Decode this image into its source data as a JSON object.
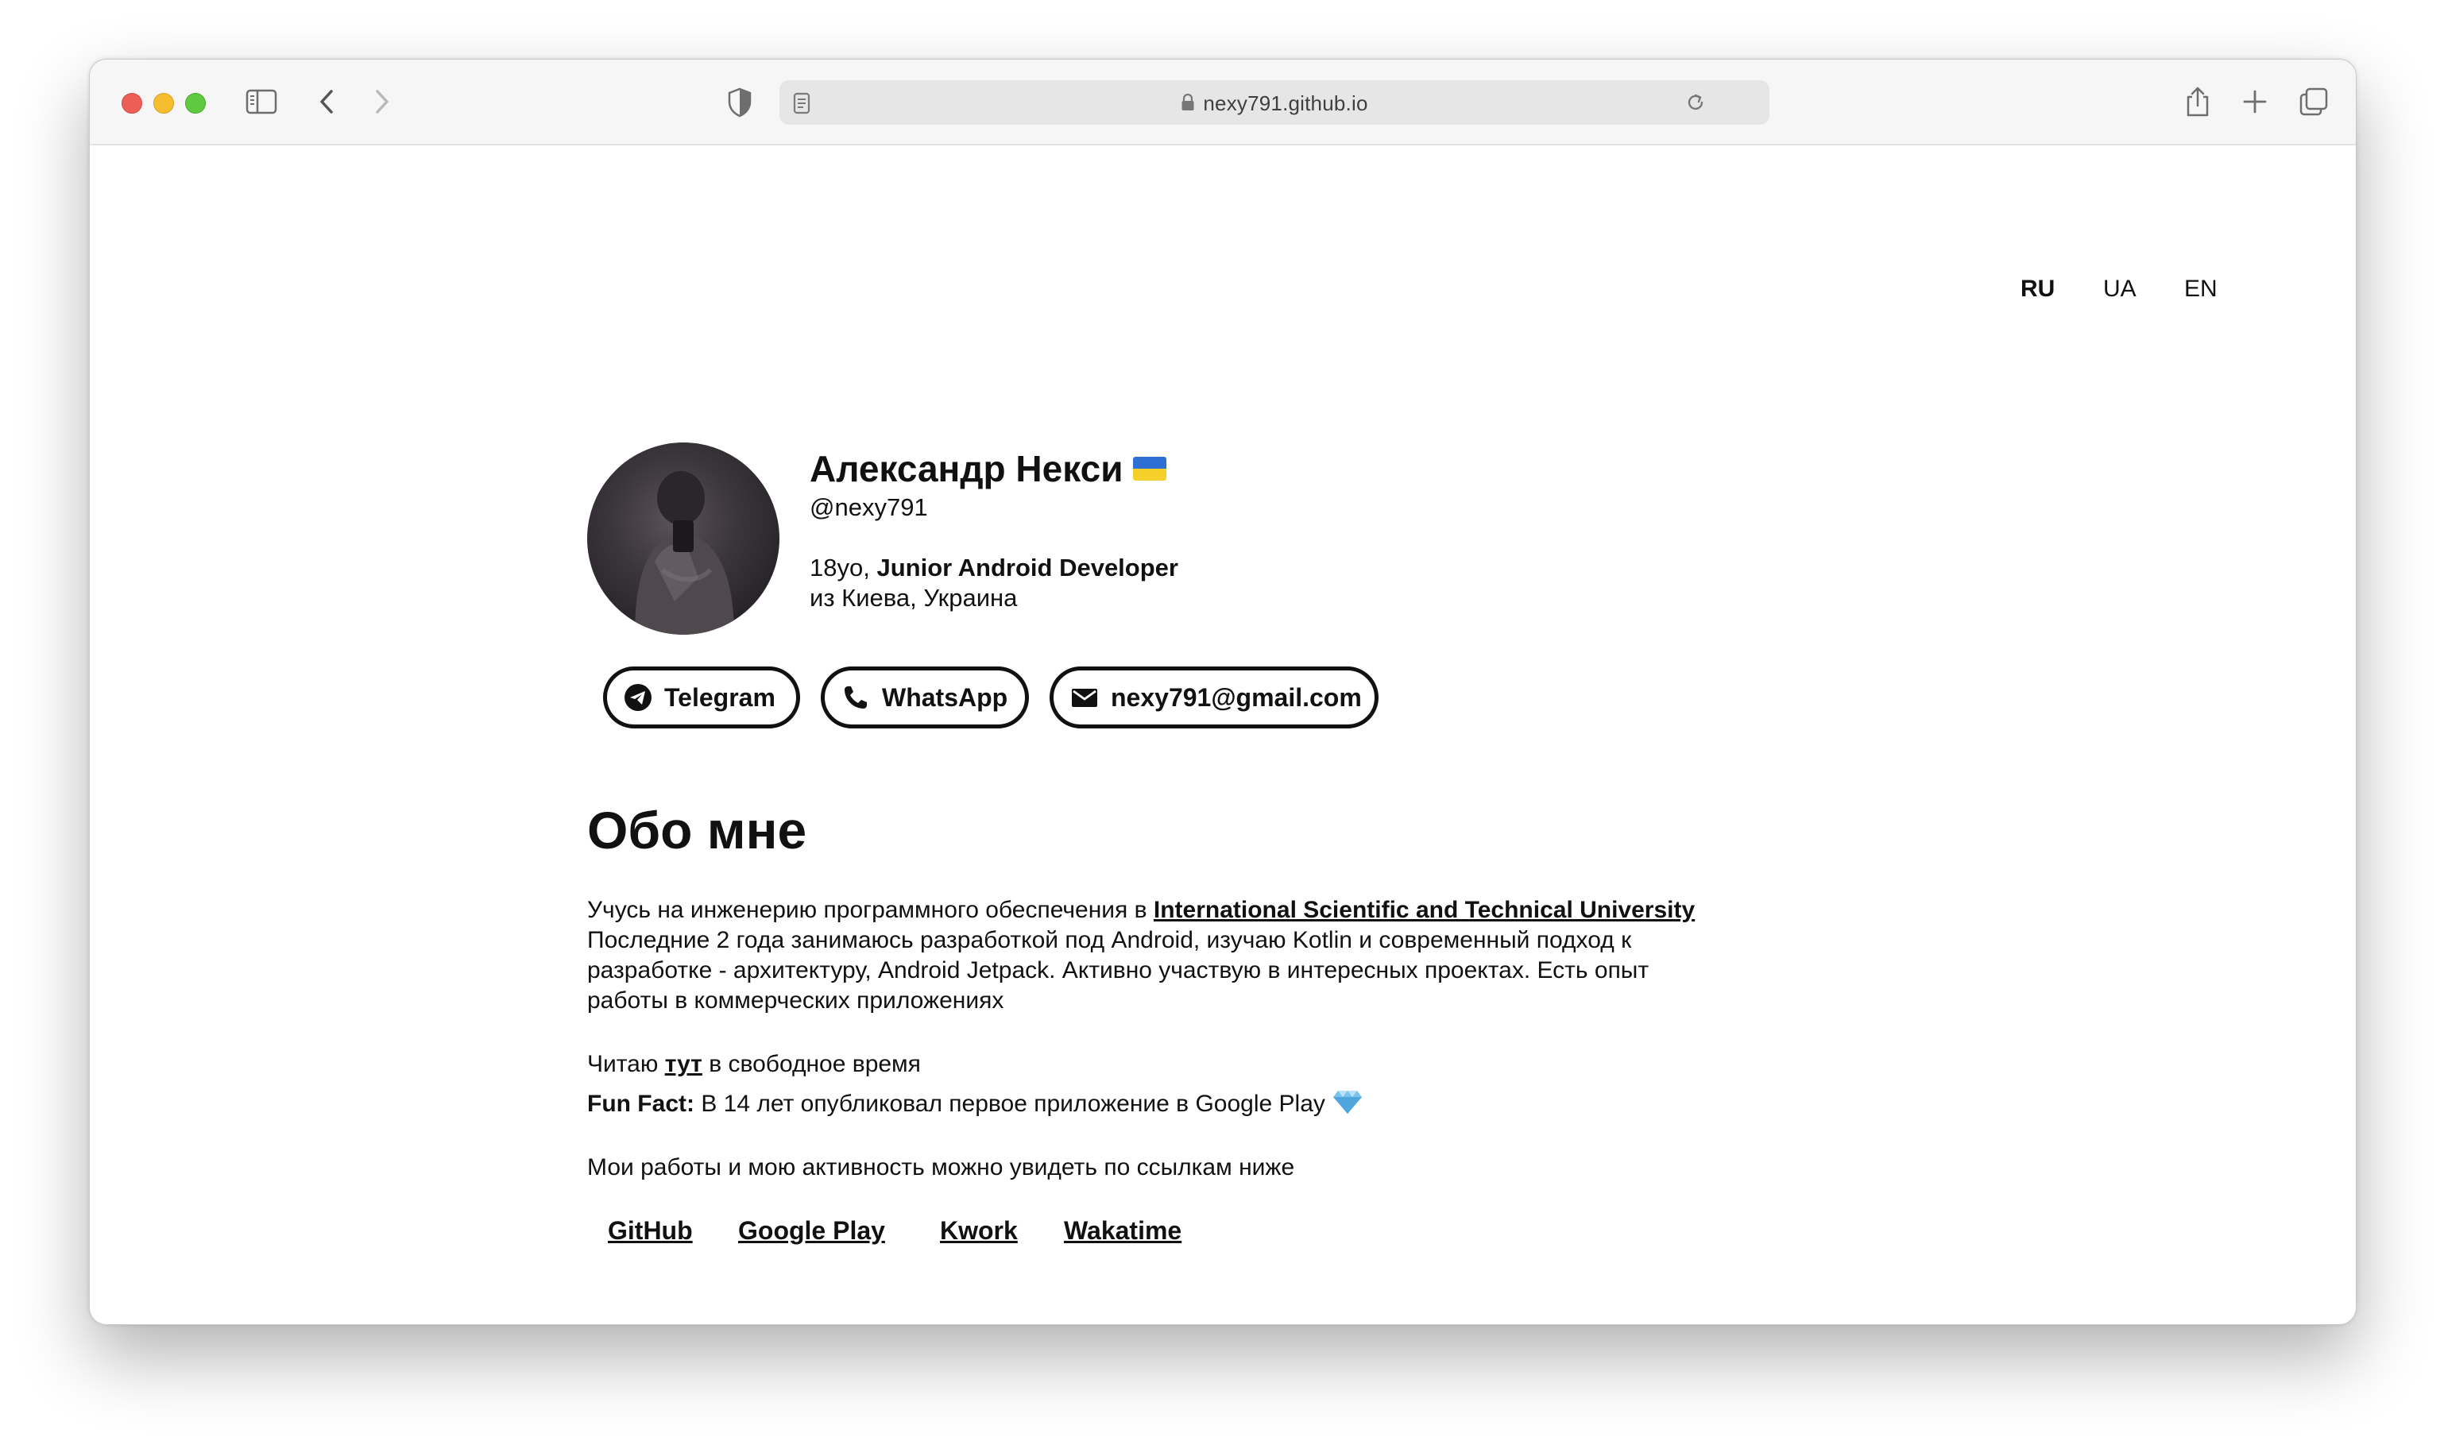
{
  "browser": {
    "url": "nexy791.github.io"
  },
  "lang": {
    "options": [
      "RU",
      "UA",
      "EN"
    ],
    "active": "RU"
  },
  "profile": {
    "name": "Александр Некси",
    "handle": "@nexy791",
    "age": "18yo,",
    "role": "Junior Android Developer",
    "location": "из Киева, Украина"
  },
  "contacts": {
    "telegram": "Telegram",
    "whatsapp": "WhatsApp",
    "email": "nexy791@gmail.com"
  },
  "about": {
    "heading": "Обо мне",
    "line1_prefix": "Учусь на инженерию программного обеспечения в ",
    "university": "International Scientific and Technical University",
    "line2": "Последние 2 года занимаюсь разработкой под Android, изучаю Kotlin и современный подход к",
    "line3": "разработке - архитектуру, Android Jetpack. Активно участвую в интересных проектах. Есть опыт",
    "line4": "работы в коммерческих приложениях",
    "reading_prefix": "Читаю ",
    "reading_link": "тут",
    "reading_suffix": " в свободное время",
    "funfact_label": "Fun Fact:",
    "funfact_text": " В 14 лет опубликовал первое приложение в Google Play ",
    "works": "Мои работы и мою активность можно увидеть по ссылкам ниже"
  },
  "links": {
    "github": "GitHub",
    "google_play": "Google Play",
    "kwork": "Kwork",
    "wakatime": "Wakatime"
  },
  "colors": {
    "flag_blue": "#2d6fd2",
    "flag_yellow": "#f5cf2a",
    "gem": "#7cc4f0"
  }
}
